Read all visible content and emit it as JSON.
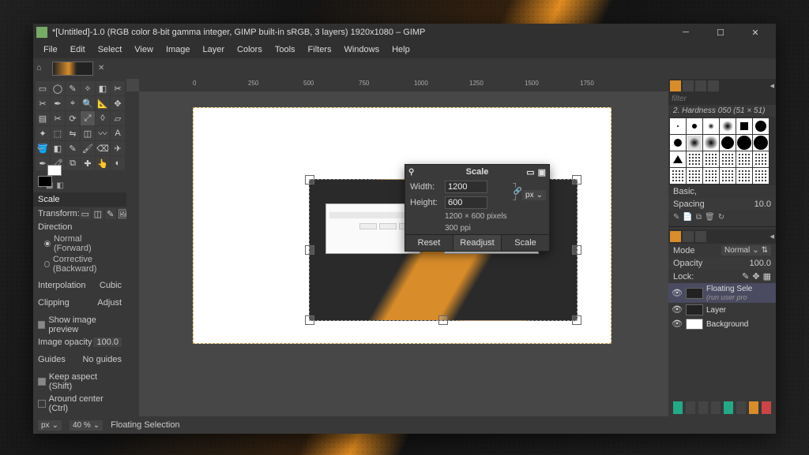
{
  "title": "*[Untitled]-1.0 (RGB color 8-bit gamma integer, GIMP built-in sRGB, 3 layers) 1920x1080 – GIMP",
  "menu": [
    "File",
    "Edit",
    "Select",
    "View",
    "Image",
    "Layer",
    "Colors",
    "Tools",
    "Filters",
    "Windows",
    "Help"
  ],
  "ruler_marks": [
    "0",
    "250",
    "500",
    "750",
    "1000",
    "1250",
    "1500",
    "1750"
  ],
  "toolbox_options": {
    "header": "Scale",
    "transform_label": "Transform:",
    "direction_label": "Direction",
    "direction_normal": "Normal (Forward)",
    "direction_corrective": "Corrective (Backward)",
    "interpolation_label": "Interpolation",
    "interpolation_value": "Cubic",
    "clipping_label": "Clipping",
    "clipping_value": "Adjust",
    "show_preview": "Show image preview",
    "image_opacity_label": "Image opacity",
    "image_opacity_value": "100.0",
    "guides_label": "Guides",
    "guides_value": "No guides",
    "keep_aspect": "Keep aspect (Shift)",
    "around_center": "Around center (Ctrl)"
  },
  "scale_dialog": {
    "title": "Scale",
    "width_label": "Width:",
    "width_value": "1200",
    "height_label": "Height:",
    "height_value": "600",
    "unit": "px",
    "info1": "1200 × 600 pixels",
    "info2": "300 ppi",
    "reset": "Reset",
    "readjust": "Readjust",
    "scale": "Scale"
  },
  "brushes": {
    "filter_placeholder": "filter",
    "current": "2. Hardness 050 (51 × 51)",
    "preset": "Basic,",
    "spacing_label": "Spacing",
    "spacing_value": "10.0"
  },
  "layers": {
    "mode_label": "Mode",
    "mode_value": "Normal",
    "opacity_label": "Opacity",
    "opacity_value": "100.0",
    "lock_label": "Lock:",
    "floating": "Floating Sele",
    "floating_sub": "(run user pro",
    "layer": "Layer",
    "background": "Background"
  },
  "status": {
    "unit": "px",
    "zoom": "40 %",
    "info": "Floating Selection"
  }
}
